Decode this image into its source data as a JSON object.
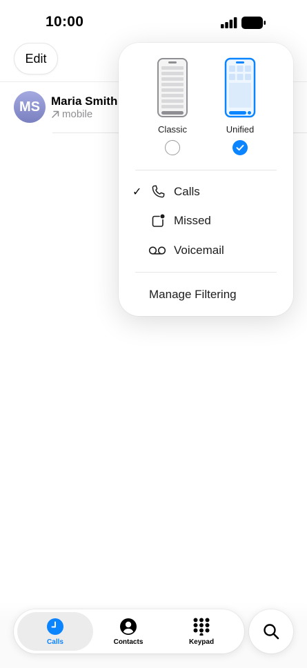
{
  "status_bar": {
    "time": "10:00"
  },
  "header": {
    "edit_label": "Edit"
  },
  "recents": [
    {
      "initials": "MS",
      "name": "Maria Smith",
      "detail": "mobile"
    }
  ],
  "popover": {
    "layouts": [
      {
        "label": "Classic",
        "selected": false
      },
      {
        "label": "Unified",
        "selected": true
      }
    ],
    "filters": [
      {
        "label": "Calls",
        "checked": true,
        "icon": "phone-icon"
      },
      {
        "label": "Missed",
        "checked": false,
        "icon": "missed-icon"
      },
      {
        "label": "Voicemail",
        "checked": false,
        "icon": "voicemail-icon"
      }
    ],
    "manage_filtering": "Manage Filtering",
    "check_mark": "✓"
  },
  "tabs": [
    {
      "label": "Calls",
      "active": true,
      "icon": "clock-icon"
    },
    {
      "label": "Contacts",
      "active": false,
      "icon": "person-icon"
    },
    {
      "label": "Keypad",
      "active": false,
      "icon": "keypad-icon"
    }
  ],
  "colors": {
    "accent": "#0a84ff",
    "secondary_text": "#8e8e93"
  }
}
